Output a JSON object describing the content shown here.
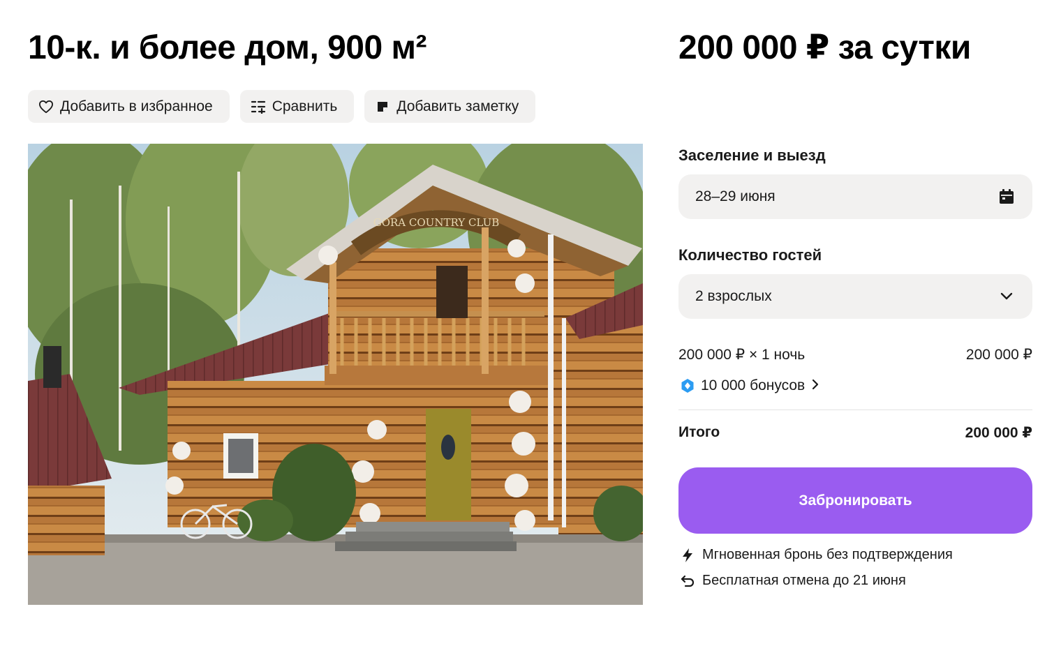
{
  "listing": {
    "title": "10-к. и более дом, 900 м²",
    "price": "200 000 ₽ за сутки"
  },
  "actions": {
    "favorite_label": "Добавить в избранное",
    "compare_label": "Сравнить",
    "note_label": "Добавить заметку"
  },
  "booking": {
    "dates_label": "Заселение и выезд",
    "dates_value": "28–29 июня",
    "guests_label": "Количество гостей",
    "guests_value": "2 взрослых",
    "line_item_label": "200 000 ₽ × 1 ночь",
    "line_item_value": "200 000 ₽",
    "bonus_text": "10 000 бонусов",
    "total_label": "Итого",
    "total_value": "200 000 ₽",
    "book_button_label": "Забронировать",
    "instant_text": "Мгновенная бронь без подтверждения",
    "cancel_text": "Бесплатная отмена до 21 июня"
  },
  "photo_sign_text": "GORA COUNTRY CLUB",
  "icons": {
    "favorite": "heart-icon",
    "compare": "compare-list-icon",
    "note": "note-icon",
    "dates": "calendar-icon",
    "guests": "chevron-down-icon",
    "bonus": "bonus-badge-icon",
    "bonus_arrow": "chevron-right-icon",
    "instant": "lightning-icon",
    "cancel": "undo-arrow-icon"
  },
  "colors": {
    "accent": "#9a5cf0",
    "bonus": "#2b9cf2",
    "chip_bg": "#f2f1f0"
  }
}
